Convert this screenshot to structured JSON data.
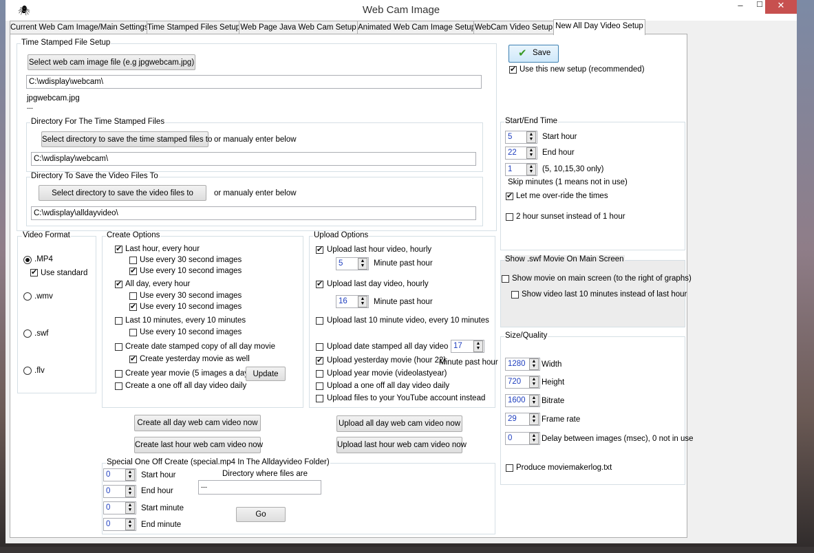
{
  "window": {
    "title": "Web Cam Image",
    "minimize": "–",
    "maximize": "☐",
    "close": "✕"
  },
  "tabs": [
    "Current Web Cam Image/Main Settings",
    "Time Stamped Files Setup",
    "Web Page Java Web Cam Setup",
    "Animated Web Cam Image Setup",
    "WebCam Video Setup",
    "New All Day Video Setup"
  ],
  "timestamped": {
    "legend": "Time Stamped File Setup",
    "select_btn": "Select web cam image file (e.g jpgwebcam.jpg)",
    "path": "C:\\wdisplay\\webcam\\",
    "filename": "jpgwebcam.jpg",
    "extra": "---",
    "dir_legend": "Directory For The Time Stamped Files",
    "dir_btn": "Select directory to save the time stamped files to",
    "manual": "or manualy enter below",
    "dir_path": "C:\\wdisplay\\webcam\\",
    "video_legend": "Directory To Save the Video Files To",
    "video_btn": "Select directory to save the video files to",
    "video_manual": "or manualy enter below",
    "video_path": "C:\\wdisplay\\alldayvideo\\"
  },
  "format": {
    "legend": "Video Format",
    "mp4": ".MP4",
    "standard": "Use standard",
    "wmv": ".wmv",
    "swf": ".swf",
    "flv": ".flv"
  },
  "create": {
    "legend": "Create Options",
    "last_hour": "Last hour, every hour",
    "lh_30": "Use every 30 second images",
    "lh_10": "Use every 10 second images",
    "all_day": "All day, every hour",
    "ad_30": "Use every 30 second images",
    "ad_10": "Use every 10 second images",
    "last10": "Last 10 minutes, every 10 minutes",
    "l10_10": "Use every 10 second images",
    "date_stamped": "Create date stamped copy of all day movie",
    "yesterday": "Create yesterday movie as well",
    "year": "Create year movie (5 images a day)",
    "update": "Update",
    "oneoff": "Create a one off all day video daily",
    "btn_all_day": "Create all day web cam video now",
    "btn_last_hour": "Create last hour web cam video now"
  },
  "upload": {
    "legend": "Upload Options",
    "last_hour": "Upload last hour video, hourly",
    "lh_min": "5",
    "minute_past": "Minute past hour",
    "last_day": "Upload last day video, hourly",
    "ld_min": "16",
    "minute_past2": "Minute past hour",
    "last10": "Upload last 10 minute video, every 10 minutes",
    "date_stamped": "Upload date stamped all day video",
    "ds_min": "17",
    "yesterday": "Upload yesterday movie (hour 22)",
    "minute_past3": "Minute past hour",
    "year": "Upload year movie (videolastyear)",
    "oneoff": "Upload a one off all day video daily",
    "youtube": "Upload files to your YouTube account instead",
    "btn_all_day": "Upload all day web cam video now",
    "btn_last_hour": "Upload last hour web cam video now"
  },
  "special": {
    "legend": "Special One Off Create (special.mp4 In The Alldayvideo Folder)",
    "start_hour": "0",
    "start_hour_lbl": "Start hour",
    "end_hour": "0",
    "end_hour_lbl": "End hour",
    "start_min": "0",
    "start_min_lbl": "Start minute",
    "end_min": "0",
    "end_min_lbl": "End minute",
    "dir_lbl": "Directory where files are",
    "dir_val": "---",
    "go": "Go"
  },
  "save": {
    "label": "Save",
    "use_new": "Use this new setup (recommended)"
  },
  "startend": {
    "legend": "Start/End Time",
    "start": "5",
    "start_lbl": "Start hour",
    "end": "22",
    "end_lbl": "End hour",
    "skip": "1",
    "skip_note": "(5, 10,15,30 only)",
    "skip_lbl": "Skip minutes (1 means not in use)",
    "override": "Let me over-ride the times",
    "sunset": "2 hour sunset instead of 1 hour"
  },
  "swf": {
    "legend": "Show .swf Movie On Main Screen",
    "show": "Show movie on main screen (to the right of graphs)",
    "last10": "Show video last 10 minutes instead of last hour"
  },
  "size": {
    "legend": "Size/Quality",
    "width": "1280",
    "width_lbl": "Width",
    "height": "720",
    "height_lbl": "Height",
    "bitrate": "1600",
    "bitrate_lbl": "Bitrate",
    "framerate": "29",
    "framerate_lbl": "Frame rate",
    "delay": "0",
    "delay_lbl": "Delay between images (msec), 0 not in use",
    "log": "Produce moviemakerlog.txt"
  }
}
